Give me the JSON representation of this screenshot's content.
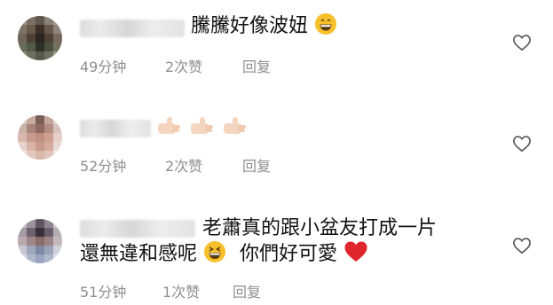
{
  "comments": [
    {
      "text": "騰騰好像波妞",
      "time": "49分钟",
      "likes": "2次赞",
      "reply": "回复",
      "emoji": "grinning-face-icon"
    },
    {
      "text": "",
      "time": "52分钟",
      "likes": "2次赞",
      "reply": "回复",
      "emoji": "thumbs-up-icon"
    },
    {
      "text_line1": "老蕭真的跟小盆友打成一片",
      "text_line2_a": "還無違和感呢",
      "text_line2_b": "你們好可愛",
      "time": "51分钟",
      "likes": "1次赞",
      "reply": "回复",
      "emoji": "laughing-face-icon",
      "emoji2": "red-heart-icon"
    }
  ],
  "colors": {
    "text": "#111111",
    "meta": "#8e8e8e",
    "heart": "#e0262d",
    "emoji_yellow": "#f7c02b"
  }
}
